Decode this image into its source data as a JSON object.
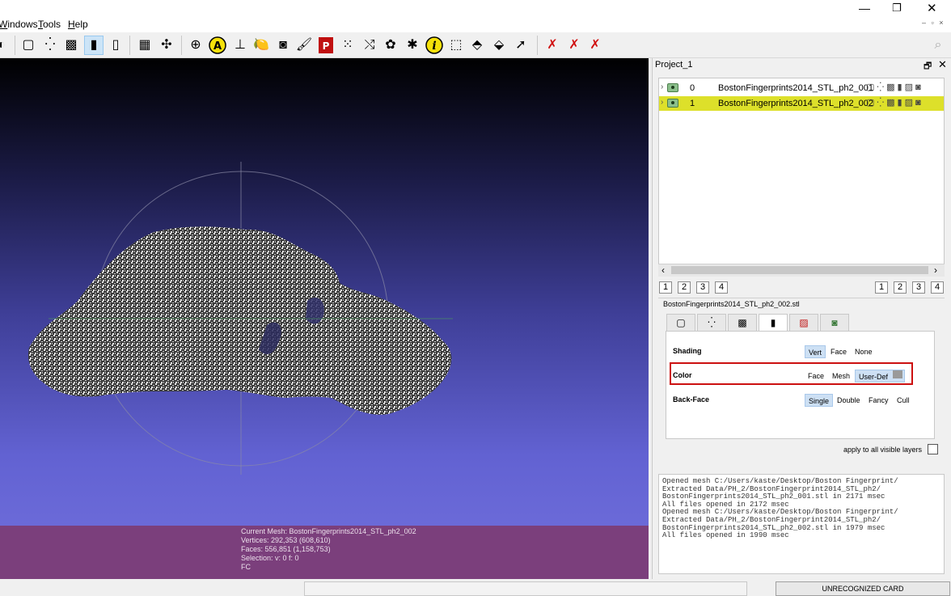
{
  "menu": {
    "windows": "indows",
    "windows_mnemonic": "W",
    "tools": "ools",
    "tools_mnemonic": "T",
    "help": "elp",
    "help_mnemonic": "H"
  },
  "window_controls": {
    "minimize": "—",
    "maximize": "❐",
    "close": "✕",
    "mdi": "– ▫ ×"
  },
  "toolbar_icons": [
    "open",
    "box-wire",
    "points",
    "wireframe-cage",
    "solid-mesh",
    "cylinder",
    "grid-mesh",
    "axes",
    "trackball",
    "annotate-a",
    "measure",
    "fruit",
    "camera",
    "brush",
    "pdf",
    "pick-points",
    "align",
    "paint",
    "georef",
    "info",
    "select",
    "select-faces",
    "select-verts",
    "pointer",
    "delete-faces",
    "delete-verts",
    "delete-all"
  ],
  "colors": {
    "viewport_top": "#000000",
    "viewport_bottom": "#6b6ad8",
    "info_bar": "#7b3f7c",
    "selected_layer": "#dde02a",
    "highlight_box": "#cc1010",
    "mesh": "#d4d4d4"
  },
  "project": {
    "title": "Project_1"
  },
  "layers": [
    {
      "index": "0",
      "name": "BostonFingerprints2014_STL_ph2_001"
    },
    {
      "index": "1",
      "name": "BostonFingerprints2014_STL_ph2_002"
    }
  ],
  "pages_left": [
    "1",
    "2",
    "3",
    "4"
  ],
  "pages_right": [
    "1",
    "2",
    "3",
    "4"
  ],
  "current_file": "BostonFingerprints2014_STL_ph2_002.stl",
  "render": {
    "shading": {
      "label": "Shading",
      "options": [
        "Vert",
        "Face",
        "None"
      ],
      "selected": "Vert"
    },
    "color": {
      "label": "Color",
      "options": [
        "Face",
        "Mesh",
        "User-Def"
      ],
      "selected": "User-Def",
      "swatch": "#9a9a9a"
    },
    "backface": {
      "label": "Back-Face",
      "options": [
        "Single",
        "Double",
        "Fancy",
        "Cull"
      ],
      "selected": "Single"
    }
  },
  "apply_all": "apply to all visible layers",
  "mesh_info": {
    "current": "Current Mesh: BostonFingerprints2014_STL_ph2_002",
    "vertices": "Vertices: 292,353    (608,610)",
    "faces": "Faces: 556,851    (1,158,753)",
    "selection": "Selection: v: 0 f: 0",
    "fc": "FC"
  },
  "log": [
    "Opened mesh C:/Users/kaste/Desktop/Boston Fingerprint/",
    "Extracted Data/PH_2/BostonFingerprint2014_STL_ph2/",
    "BostonFingerprints2014_STL_ph2_001.stl in 2171 msec",
    "All files opened in 2172 msec",
    "Opened mesh C:/Users/kaste/Desktop/Boston Fingerprint/",
    "Extracted Data/PH_2/BostonFingerprint2014_STL_ph2/",
    "BostonFingerprints2014_STL_ph2_002.stl in 1979 msec",
    "All files opened in 1990 msec"
  ],
  "status": {
    "card": "UNRECOGNIZED CARD"
  }
}
